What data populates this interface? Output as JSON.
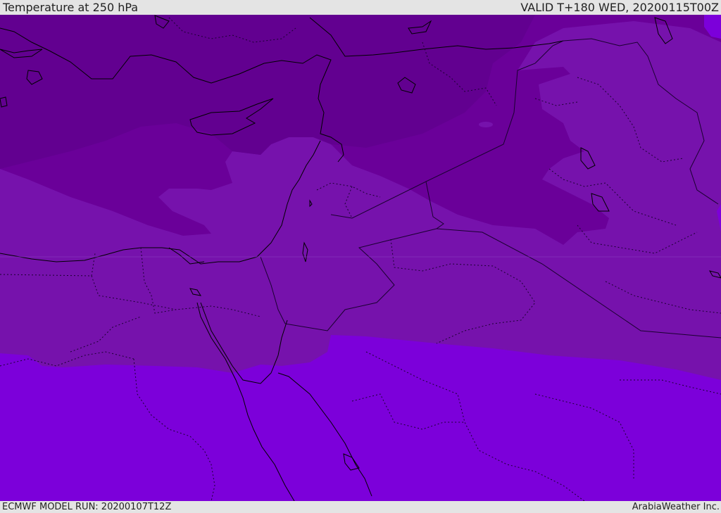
{
  "header": {
    "title": "Temperature at 250 hPa",
    "valid": "VALID T+180 WED, 20200115T00Z"
  },
  "footer": {
    "model_run": "ECMWF MODEL RUN: 20200107T12Z",
    "credit": "ArabiaWeather Inc."
  },
  "map": {
    "variable": "temperature-250hpa",
    "colors": {
      "coldest": "#620090",
      "cold": "#6a0099",
      "mid": "#7612ac",
      "warm": "#7c00da",
      "coastline": "#000000",
      "border": "#1a0030"
    }
  }
}
